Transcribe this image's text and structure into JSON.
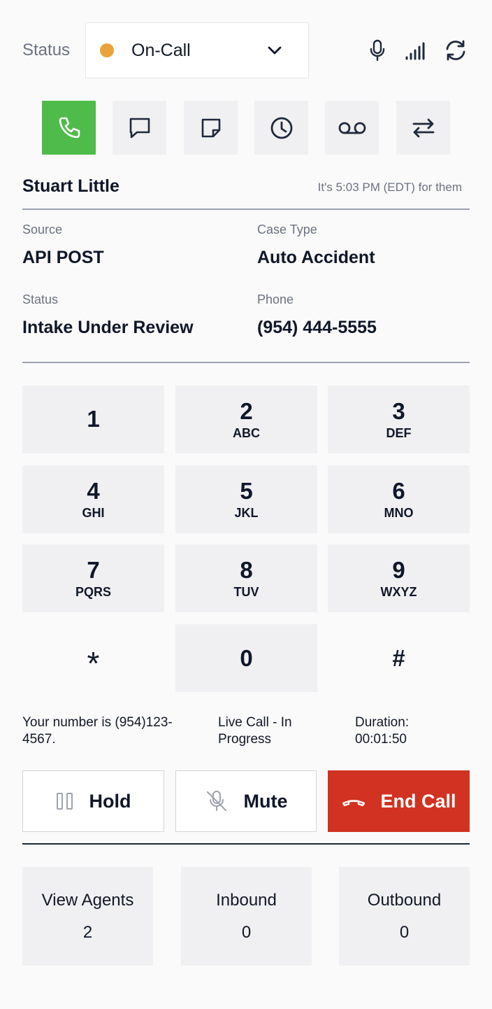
{
  "header": {
    "status_label": "Status",
    "status_value": "On-Call",
    "status_color": "#e8a33a",
    "icons": [
      "microphone-icon",
      "signal-icon",
      "refresh-icon"
    ]
  },
  "tabs": [
    {
      "name": "phone",
      "active": true
    },
    {
      "name": "chat"
    },
    {
      "name": "note"
    },
    {
      "name": "history"
    },
    {
      "name": "voicemail"
    },
    {
      "name": "transfer"
    }
  ],
  "contact": {
    "name": "Stuart Little",
    "local_time": "It's 5:03 PM (EDT) for them",
    "fields": {
      "source_label": "Source",
      "source_value": "API POST",
      "case_type_label": "Case Type",
      "case_type_value": "Auto Accident",
      "status_label": "Status",
      "status_value": "Intake Under Review",
      "phone_label": "Phone",
      "phone_value": "(954) 444-5555"
    }
  },
  "keypad": [
    {
      "digit": "1",
      "letters": ""
    },
    {
      "digit": "2",
      "letters": "ABC"
    },
    {
      "digit": "3",
      "letters": "DEF"
    },
    {
      "digit": "4",
      "letters": "GHI"
    },
    {
      "digit": "5",
      "letters": "JKL"
    },
    {
      "digit": "6",
      "letters": "MNO"
    },
    {
      "digit": "7",
      "letters": "PQRS"
    },
    {
      "digit": "8",
      "letters": "TUV"
    },
    {
      "digit": "9",
      "letters": "WXYZ"
    },
    {
      "digit": "*",
      "letters": ""
    },
    {
      "digit": "0",
      "letters": ""
    },
    {
      "digit": "#",
      "letters": ""
    }
  ],
  "call_info": {
    "your_number": "Your number is (954)123-4567.",
    "call_state": "Live Call - In Progress",
    "duration_label": "Duration:",
    "duration_value": "00:01:50"
  },
  "controls": {
    "hold": "Hold",
    "mute": "Mute",
    "end_call": "End Call",
    "end_call_color": "#d13221"
  },
  "stats": [
    {
      "label": "View Agents",
      "value": "2"
    },
    {
      "label": "Inbound",
      "value": "0"
    },
    {
      "label": "Outbound",
      "value": "0"
    }
  ]
}
